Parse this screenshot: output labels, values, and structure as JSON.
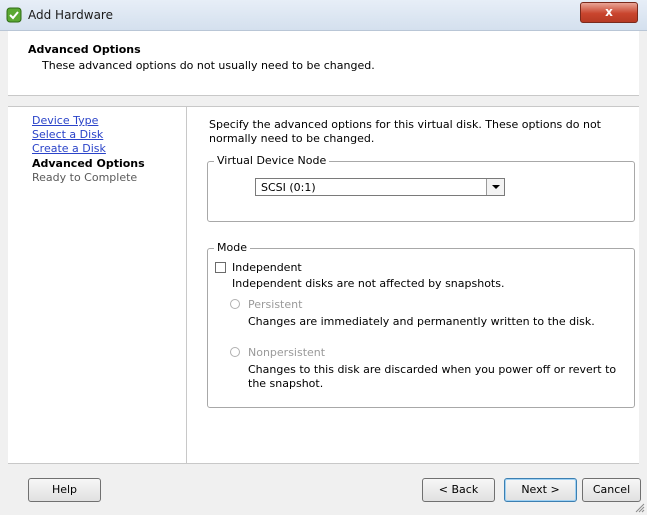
{
  "window": {
    "title": "Add Hardware",
    "close_label": "x"
  },
  "header": {
    "title": "Advanced Options",
    "subtitle": "These advanced options do not usually need to be changed."
  },
  "nav": {
    "items": [
      {
        "label": "Device Type",
        "state": "link"
      },
      {
        "label": "Select a Disk",
        "state": "link"
      },
      {
        "label": "Create a Disk",
        "state": "link"
      },
      {
        "label": "Advanced Options",
        "state": "current"
      },
      {
        "label": "Ready to Complete",
        "state": "pending"
      }
    ]
  },
  "main": {
    "description": "Specify the advanced options for this virtual disk. These options do not normally need to be changed.",
    "virtual_device_node": {
      "legend": "Virtual Device Node",
      "selected": "SCSI (0:1)"
    },
    "mode": {
      "legend": "Mode",
      "independent_label": "Independent",
      "independent_checked": false,
      "independent_desc": "Independent disks are not affected by snapshots.",
      "persistent_label": "Persistent",
      "persistent_desc": "Changes are immediately and permanently written to the disk.",
      "nonpersistent_label": "Nonpersistent",
      "nonpersistent_desc": "Changes to this disk are discarded when you power off or revert to the snapshot."
    }
  },
  "footer": {
    "help_label": "Help",
    "back_label": "< Back",
    "next_label": "Next >",
    "cancel_label": "Cancel"
  },
  "colors": {
    "link": "#2a43c9",
    "close_button": "#c9452e",
    "disabled_text": "#9a9a9a"
  }
}
